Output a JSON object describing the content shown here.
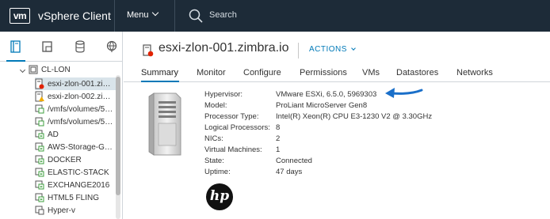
{
  "topbar": {
    "logo_text": "vm",
    "app_title": "vSphere Client",
    "menu_label": "Menu",
    "search_label": "Search"
  },
  "sidebar": {
    "tabs": [
      "hosts-and-clusters",
      "vms-and-templates",
      "storage",
      "networking"
    ],
    "tree": [
      {
        "label": "CL-LON",
        "icon": "cluster-icon",
        "level": 0
      },
      {
        "label": "esxi-zlon-001.zimbra.io",
        "display": "esxi-zlon-001.zi…",
        "icon": "host-error-icon",
        "selected": true
      },
      {
        "label": "esxi-zlon-002.zi…",
        "icon": "host-warning-icon"
      },
      {
        "label": "/vmfs/volumes/5…",
        "icon": "vm-icon"
      },
      {
        "label": "/vmfs/volumes/5…",
        "icon": "vm-icon"
      },
      {
        "label": "AD",
        "icon": "vm-icon"
      },
      {
        "label": "AWS-Storage-G…",
        "icon": "vm-icon"
      },
      {
        "label": "DOCKER",
        "icon": "vm-icon"
      },
      {
        "label": "ELASTIC-STACK",
        "icon": "vm-icon"
      },
      {
        "label": "EXCHANGE2016",
        "icon": "vm-icon"
      },
      {
        "label": "HTML5 FLING",
        "icon": "vm-icon"
      },
      {
        "label": "Hyper-v",
        "icon": "vm-icon"
      }
    ]
  },
  "main": {
    "title": "esxi-zlon-001.zimbra.io",
    "actions_label": "ACTIONS",
    "tabs": [
      "Summary",
      "Monitor",
      "Configure",
      "Permissions",
      "VMs",
      "Datastores",
      "Networks"
    ],
    "active_tab": "Summary",
    "info": [
      {
        "label": "Hypervisor:",
        "value": "VMware ESXi, 6.5.0, 5969303"
      },
      {
        "label": "Model:",
        "value": "ProLiant MicroServer Gen8"
      },
      {
        "label": "Processor Type:",
        "value": "Intel(R) Xeon(R) CPU E3-1230 V2 @ 3.30GHz"
      },
      {
        "label": "Logical Processors:",
        "value": "8"
      },
      {
        "label": "NICs:",
        "value": "2"
      },
      {
        "label": "Virtual Machines:",
        "value": "1"
      },
      {
        "label": "State:",
        "value": "Connected"
      },
      {
        "label": "Uptime:",
        "value": "47 days"
      }
    ],
    "vendor_logo_text": "hp"
  },
  "colors": {
    "topbar_bg": "#1d2b38",
    "accent": "#0079b8",
    "selected_row": "#d9e4ea",
    "error": "#e12200",
    "warning": "#f0ab00",
    "vm_green": "#3c9f3c",
    "annotation_arrow": "#1a6fc9"
  }
}
